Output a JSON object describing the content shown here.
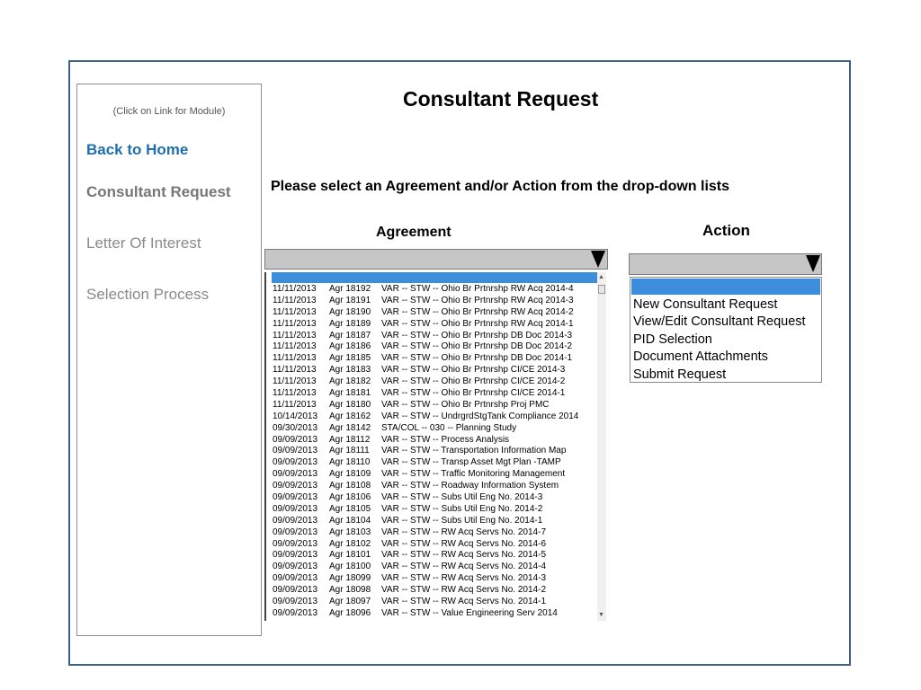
{
  "page": {
    "title": "Consultant Request",
    "instruction": "Please select an Agreement and/or Action from the drop-down lists"
  },
  "sidebar": {
    "hint": "(Click on Link for Module)",
    "items": [
      {
        "label": "Back to Home"
      },
      {
        "label": "Consultant Request"
      },
      {
        "label": "Letter Of Interest"
      },
      {
        "label": "Selection Process"
      }
    ]
  },
  "agreement": {
    "label": "Agreement",
    "selected": "",
    "options": [
      [
        "11/11/2013",
        "Agr 18192",
        "VAR -- STW -- Ohio Br Prtnrshp RW Acq 2014-4"
      ],
      [
        "11/11/2013",
        "Agr 18191",
        "VAR -- STW -- Ohio Br Prtnrshp RW Acq 2014-3"
      ],
      [
        "11/11/2013",
        "Agr 18190",
        "VAR -- STW -- Ohio Br Prtnrshp RW Acq 2014-2"
      ],
      [
        "11/11/2013",
        "Agr 18189",
        "VAR -- STW -- Ohio Br Prtnrshp RW Acq 2014-1"
      ],
      [
        "11/11/2013",
        "Agr 18187",
        "VAR -- STW -- Ohio Br Prtnrshp DB Doc 2014-3"
      ],
      [
        "11/11/2013",
        "Agr 18186",
        "VAR -- STW -- Ohio Br Prtnrshp DB Doc 2014-2"
      ],
      [
        "11/11/2013",
        "Agr 18185",
        "VAR -- STW -- Ohio Br Prtnrshp DB Doc 2014-1"
      ],
      [
        "11/11/2013",
        "Agr 18183",
        "VAR -- STW -- Ohio Br Prtnrshp CI/CE 2014-3"
      ],
      [
        "11/11/2013",
        "Agr 18182",
        "VAR -- STW -- Ohio Br Prtnrshp CI/CE 2014-2"
      ],
      [
        "11/11/2013",
        "Agr 18181",
        "VAR -- STW -- Ohio Br Prtnrshp CI/CE 2014-1"
      ],
      [
        "11/11/2013",
        "Agr 18180",
        "VAR -- STW -- Ohio Br Prtnrshp Proj PMC"
      ],
      [
        "10/14/2013",
        "Agr 18162",
        "VAR -- STW -- UndrgrdStgTank Compliance 2014"
      ],
      [
        "09/30/2013",
        "Agr 18142",
        "STA/COL -- 030 -- Planning Study"
      ],
      [
        "09/09/2013",
        "Agr 18112",
        "VAR -- STW -- Process Analysis"
      ],
      [
        "09/09/2013",
        "Agr 18111",
        "VAR -- STW -- Transportation Information Map"
      ],
      [
        "09/09/2013",
        "Agr 18110",
        "VAR -- STW -- Transp Asset Mgt Plan -TAMP"
      ],
      [
        "09/09/2013",
        "Agr 18109",
        "VAR -- STW -- Traffic Monitoring Management"
      ],
      [
        "09/09/2013",
        "Agr 18108",
        "VAR -- STW -- Roadway Information System"
      ],
      [
        "09/09/2013",
        "Agr 18106",
        "VAR -- STW -- Subs Util Eng No. 2014-3"
      ],
      [
        "09/09/2013",
        "Agr 18105",
        "VAR -- STW -- Subs Util Eng No. 2014-2"
      ],
      [
        "09/09/2013",
        "Agr 18104",
        "VAR -- STW -- Subs Util Eng No. 2014-1"
      ],
      [
        "09/09/2013",
        "Agr 18103",
        "VAR -- STW -- RW Acq Servs No. 2014-7"
      ],
      [
        "09/09/2013",
        "Agr 18102",
        "VAR -- STW -- RW Acq Servs No. 2014-6"
      ],
      [
        "09/09/2013",
        "Agr 18101",
        "VAR -- STW -- RW Acq Servs No. 2014-5"
      ],
      [
        "09/09/2013",
        "Agr 18100",
        "VAR -- STW -- RW Acq Servs No. 2014-4"
      ],
      [
        "09/09/2013",
        "Agr 18099",
        "VAR -- STW -- RW Acq Servs No. 2014-3"
      ],
      [
        "09/09/2013",
        "Agr 18098",
        "VAR -- STW -- RW Acq Servs No. 2014-2"
      ],
      [
        "09/09/2013",
        "Agr 18097",
        "VAR -- STW -- RW Acq Servs No. 2014-1"
      ],
      [
        "09/09/2013",
        "Agr 18096",
        "VAR -- STW -- Value Engineering Serv 2014"
      ]
    ]
  },
  "action": {
    "label": "Action",
    "selected": "",
    "options": [
      "New Consultant Request",
      "View/Edit Consultant Request",
      "PID Selection",
      "Document Attachments",
      "Submit Request"
    ]
  },
  "icons": {
    "dropdown": "chevron-down-icon",
    "scroll_up": "scroll-up-icon",
    "scroll_down": "scroll-down-icon"
  },
  "colors": {
    "frame": "#3f6083",
    "link": "#1f6fae",
    "highlight": "#3c8ddc",
    "dropdown": "#c6c6c6"
  }
}
